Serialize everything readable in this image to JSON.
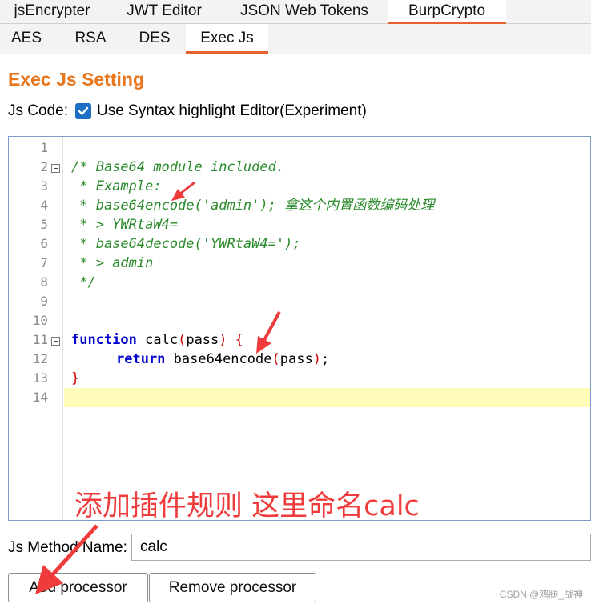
{
  "top_tabs": [
    "jsEncrypter",
    "JWT Editor",
    "JSON Web Tokens",
    "BurpCrypto"
  ],
  "sub_tabs": [
    "AES",
    "RSA",
    "DES",
    "Exec Js"
  ],
  "section_title": "Exec Js Setting",
  "js_code_label": "Js Code:",
  "syntax_checkbox": {
    "label": "Use Syntax highlight Editor(Experiment)",
    "checked": true
  },
  "editor": {
    "line_numbers": [
      "1",
      "2",
      "3",
      "4",
      "5",
      "6",
      "7",
      "8",
      "9",
      "10",
      "11",
      "12",
      "13",
      "14"
    ],
    "lines": [
      "",
      "/* Base64 module included.",
      " * Example:",
      " * base64encode('admin'); 拿这个内置函数编码处理",
      " * > YWRtaW4=",
      " * base64decode('YWRtaW4=');",
      " * > admin",
      " */",
      "",
      "",
      "function calc(pass) {",
      "    return base64encode(pass);",
      "}",
      ""
    ],
    "tokens": {
      "function_kw": "function",
      "calc_sig": " calc",
      "open_paren": "(",
      "pass_param": "pass",
      "close_paren_brace": ") {",
      "return_kw": "return",
      "base64_call": " base64encode",
      "call_open": "(",
      "call_arg": "pass",
      "call_close": ")",
      "semicolon": ";",
      "closing_brace": "}"
    }
  },
  "annotation": "添加插件规则  这里命名calc",
  "method_label": "Js Method Name:",
  "method_value": "calc",
  "buttons": {
    "add": "Add processor",
    "remove": "Remove processor"
  },
  "watermark": "CSDN @鸡腿_战神",
  "colors": {
    "accent": "#e8612c",
    "title": "#e8761d",
    "annotation": "#ef3b3b",
    "comment": "#2a8a2a",
    "keyword": "#0000cc"
  }
}
